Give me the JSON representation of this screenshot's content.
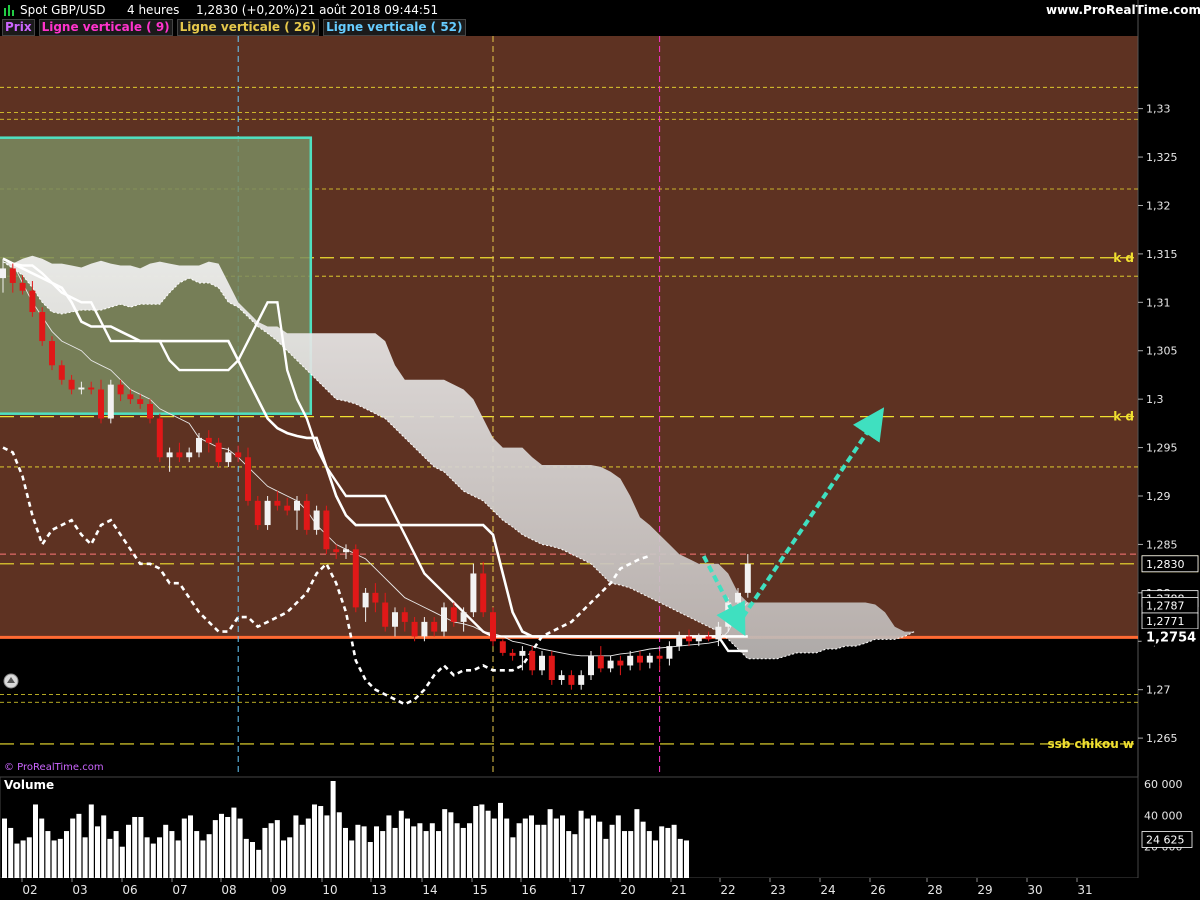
{
  "header": {
    "instrument": "Spot GBP/USD",
    "timeframe": "4 heures",
    "last_change": "1,2830 (+0,20%)",
    "datetime": "21 août 2018 09:44:51",
    "site": "www.ProRealTime.com"
  },
  "legend": [
    {
      "label": "Prix",
      "color": "#cc66ff"
    },
    {
      "label": "Ligne verticale ( 9)",
      "color": "#ff33cc"
    },
    {
      "label": "Ligne verticale ( 26)",
      "color": "#e6c84b"
    },
    {
      "label": "Ligne verticale ( 52)",
      "color": "#66ccff"
    }
  ],
  "watermark": "© ProRealTime.com",
  "colors": {
    "upper_zone": "#5e3222",
    "lower_zone": "#000000",
    "bull_candle": "#f2f2f2",
    "bear_candle": "#e01818",
    "support_line": "#ff6a33",
    "box_fill": "#7a8c60",
    "box_border": "#4fe0c0",
    "arrow": "#3fe0c0",
    "level_line": "#f0e030",
    "cloud": "#bdb8b6"
  },
  "chart_data": {
    "type": "candlestick",
    "y_axis": {
      "ticks": [
        "1,33",
        "1,325",
        "1,32",
        "1,315",
        "1,31",
        "1,305",
        "1,3",
        "1,295",
        "1,29",
        "1,285",
        "1,28",
        "1,275",
        "1,27",
        "1,265"
      ],
      "range": [
        1.2615,
        1.3375
      ]
    },
    "x_axis": {
      "ticks": [
        "02",
        "03",
        "06",
        "07",
        "08",
        "09",
        "10",
        "13",
        "14",
        "15",
        "16",
        "17",
        "20",
        "21",
        "22",
        "23",
        "24",
        "26",
        "28",
        "29",
        "30",
        "31"
      ]
    },
    "price_badges": [
      {
        "text": "1,2830",
        "value": 1.283,
        "style": "last"
      },
      {
        "text": "1,2830",
        "value": 1.283,
        "style": "dark"
      },
      {
        "text": "1,2788",
        "value": 1.2794,
        "style": "dark"
      },
      {
        "text": "1,2787",
        "value": 1.2787,
        "style": "dark"
      },
      {
        "text": "1,2771",
        "value": 1.2771,
        "style": "dark"
      },
      {
        "text": "1,2754",
        "value": 1.2754,
        "style": "support"
      }
    ],
    "level_labels": [
      {
        "text": "k d",
        "value": 1.3146
      },
      {
        "text": "k d",
        "value": 1.2982
      },
      {
        "text": "ssb chikou w",
        "value": 1.2644
      }
    ],
    "horizontal_levels": [
      1.3322,
      1.3296,
      1.3289,
      1.3217,
      1.3146,
      1.3127,
      1.2982,
      1.293,
      1.283,
      1.2695,
      1.2687,
      1.2644
    ],
    "support_level": 1.2754,
    "red_dash_level": 1.284,
    "vertical_lines": [
      {
        "index": 9,
        "color": "#ff33cc"
      },
      {
        "index": 26,
        "color": "#e6c84b"
      },
      {
        "index": 52,
        "color": "#66ccff"
      }
    ],
    "candles": [
      [
        1.3125,
        1.3145,
        1.311,
        1.3135
      ],
      [
        1.3135,
        1.314,
        1.311,
        1.312
      ],
      [
        1.312,
        1.3128,
        1.3108,
        1.3112
      ],
      [
        1.3112,
        1.3122,
        1.3085,
        1.309
      ],
      [
        1.309,
        1.3095,
        1.3055,
        1.306
      ],
      [
        1.306,
        1.3065,
        1.303,
        1.3035
      ],
      [
        1.3035,
        1.304,
        1.3015,
        1.302
      ],
      [
        1.302,
        1.3025,
        1.3005,
        1.301
      ],
      [
        1.301,
        1.3018,
        1.3005,
        1.3012
      ],
      [
        1.3012,
        1.3018,
        1.3005,
        1.301
      ],
      [
        1.301,
        1.302,
        1.2975,
        1.298
      ],
      [
        1.298,
        1.302,
        1.2975,
        1.3015
      ],
      [
        1.3015,
        1.302,
        1.2998,
        1.3005
      ],
      [
        1.3005,
        1.301,
        1.2995,
        1.3
      ],
      [
        1.3,
        1.3005,
        1.299,
        1.2995
      ],
      [
        1.2995,
        1.3,
        1.2975,
        1.298
      ],
      [
        1.298,
        1.2985,
        1.2935,
        1.294
      ],
      [
        1.294,
        1.295,
        1.2925,
        1.2945
      ],
      [
        1.2945,
        1.2955,
        1.2935,
        1.294
      ],
      [
        1.294,
        1.295,
        1.2935,
        1.2945
      ],
      [
        1.2945,
        1.2965,
        1.294,
        1.296
      ],
      [
        1.296,
        1.2968,
        1.2945,
        1.2955
      ],
      [
        1.2955,
        1.296,
        1.293,
        1.2935
      ],
      [
        1.2935,
        1.295,
        1.293,
        1.2945
      ],
      [
        1.2945,
        1.2952,
        1.2935,
        1.294
      ],
      [
        1.294,
        1.295,
        1.289,
        1.2895
      ],
      [
        1.2895,
        1.29,
        1.2865,
        1.287
      ],
      [
        1.287,
        1.29,
        1.2865,
        1.2895
      ],
      [
        1.2895,
        1.2905,
        1.2885,
        1.289
      ],
      [
        1.289,
        1.2898,
        1.288,
        1.2885
      ],
      [
        1.2885,
        1.29,
        1.2865,
        1.2895
      ],
      [
        1.2895,
        1.2902,
        1.286,
        1.2865
      ],
      [
        1.2865,
        1.289,
        1.286,
        1.2885
      ],
      [
        1.2885,
        1.289,
        1.284,
        1.2845
      ],
      [
        1.2845,
        1.285,
        1.2835,
        1.2842
      ],
      [
        1.2842,
        1.285,
        1.2835,
        1.2845
      ],
      [
        1.2845,
        1.285,
        1.278,
        1.2785
      ],
      [
        1.2785,
        1.2805,
        1.277,
        1.28
      ],
      [
        1.28,
        1.281,
        1.278,
        1.279
      ],
      [
        1.279,
        1.28,
        1.276,
        1.2765
      ],
      [
        1.2765,
        1.2785,
        1.2755,
        1.278
      ],
      [
        1.278,
        1.2785,
        1.276,
        1.277
      ],
      [
        1.277,
        1.2775,
        1.275,
        1.2755
      ],
      [
        1.2755,
        1.2775,
        1.275,
        1.277
      ],
      [
        1.277,
        1.2775,
        1.2755,
        1.276
      ],
      [
        1.276,
        1.279,
        1.2755,
        1.2785
      ],
      [
        1.2785,
        1.279,
        1.2765,
        1.277
      ],
      [
        1.277,
        1.2785,
        1.276,
        1.278
      ],
      [
        1.278,
        1.283,
        1.2775,
        1.282
      ],
      [
        1.282,
        1.2832,
        1.2775,
        1.278
      ],
      [
        1.278,
        1.2785,
        1.2745,
        1.275
      ],
      [
        1.275,
        1.2752,
        1.2735,
        1.2738
      ],
      [
        1.2738,
        1.2742,
        1.273,
        1.2735
      ],
      [
        1.2735,
        1.2745,
        1.272,
        1.274
      ],
      [
        1.274,
        1.2745,
        1.2715,
        1.272
      ],
      [
        1.272,
        1.274,
        1.2715,
        1.2735
      ],
      [
        1.2735,
        1.274,
        1.2705,
        1.271
      ],
      [
        1.271,
        1.272,
        1.2705,
        1.2715
      ],
      [
        1.2715,
        1.272,
        1.27,
        1.2705
      ],
      [
        1.2705,
        1.272,
        1.27,
        1.2715
      ],
      [
        1.2715,
        1.274,
        1.271,
        1.2735
      ],
      [
        1.2735,
        1.2745,
        1.2718,
        1.2722
      ],
      [
        1.2722,
        1.2735,
        1.2718,
        1.273
      ],
      [
        1.273,
        1.2735,
        1.2715,
        1.2725
      ],
      [
        1.2725,
        1.274,
        1.272,
        1.2735
      ],
      [
        1.2735,
        1.274,
        1.272,
        1.2728
      ],
      [
        1.2728,
        1.2738,
        1.2722,
        1.2735
      ],
      [
        1.2735,
        1.274,
        1.272,
        1.2732
      ],
      [
        1.2732,
        1.275,
        1.2725,
        1.2745
      ],
      [
        1.2745,
        1.276,
        1.274,
        1.2755
      ],
      [
        1.2755,
        1.2762,
        1.2745,
        1.275
      ],
      [
        1.275,
        1.2758,
        1.2745,
        1.2755
      ],
      [
        1.2755,
        1.276,
        1.275,
        1.2752
      ],
      [
        1.2752,
        1.277,
        1.2745,
        1.2765
      ],
      [
        1.2765,
        1.2795,
        1.276,
        1.279
      ],
      [
        1.279,
        1.2805,
        1.2785,
        1.28
      ],
      [
        1.28,
        1.284,
        1.2795,
        1.283
      ]
    ],
    "tenkan": [
      1.3145,
      1.314,
      1.3138,
      1.3138,
      1.313,
      1.312,
      1.311,
      1.3105,
      1.31,
      1.31,
      1.308,
      1.306,
      1.306,
      1.306,
      1.306,
      1.306,
      1.306,
      1.304,
      1.303,
      1.303,
      1.303,
      1.303,
      1.303,
      1.303,
      1.304,
      1.306,
      1.308,
      1.31,
      1.31,
      1.303,
      1.3,
      1.298,
      1.295,
      1.293,
      1.2915,
      1.29,
      1.29,
      1.29,
      1.29,
      1.29,
      1.288,
      1.286,
      1.284,
      1.282,
      1.281,
      1.28,
      1.279,
      1.278,
      1.277,
      1.276,
      1.2755,
      1.2755,
      1.2755,
      1.2755,
      1.2755,
      1.2755,
      1.2755,
      1.2755,
      1.2755,
      1.2755,
      1.2755,
      1.2755,
      1.2755,
      1.2755,
      1.2755,
      1.2755,
      1.2755,
      1.2755,
      1.2755,
      1.2755,
      1.2755,
      1.2755,
      1.2755,
      1.2755,
      1.274,
      1.274,
      1.274
    ],
    "kijun": [
      1.3145,
      1.314,
      1.3135,
      1.313,
      1.3125,
      1.312,
      1.3115,
      1.31,
      1.308,
      1.3075,
      1.3075,
      1.3075,
      1.307,
      1.3065,
      1.306,
      1.306,
      1.306,
      1.306,
      1.306,
      1.306,
      1.306,
      1.306,
      1.306,
      1.306,
      1.304,
      1.302,
      1.3,
      1.298,
      1.297,
      1.2965,
      1.2962,
      1.296,
      1.296,
      1.293,
      1.29,
      1.288,
      1.287,
      1.287,
      1.287,
      1.287,
      1.287,
      1.287,
      1.287,
      1.287,
      1.287,
      1.287,
      1.287,
      1.287,
      1.287,
      1.287,
      1.286,
      1.282,
      1.278,
      1.276,
      1.2755,
      1.2755,
      1.2755,
      1.2755,
      1.2755,
      1.2755,
      1.2755,
      1.2755,
      1.2755,
      1.2755,
      1.2755,
      1.2755,
      1.2755,
      1.2755,
      1.2755,
      1.2755,
      1.2755,
      1.2755,
      1.2755,
      1.2755,
      1.2755,
      1.2755,
      1.2755
    ],
    "kijun_thin": [
      1.3145,
      1.314,
      1.312,
      1.31,
      1.3085,
      1.307,
      1.306,
      1.3055,
      1.305,
      1.304,
      1.3035,
      1.303,
      1.302,
      1.301,
      1.3005,
      1.3,
      1.299,
      1.2985,
      1.298,
      1.2975,
      1.296,
      1.2955,
      1.295,
      1.2948,
      1.294,
      1.293,
      1.292,
      1.291,
      1.2905,
      1.29,
      1.2895,
      1.2885,
      1.287,
      1.286,
      1.285,
      1.2845,
      1.284,
      1.2835,
      1.2825,
      1.2815,
      1.2805,
      1.2795,
      1.279,
      1.2785,
      1.278,
      1.2775,
      1.277,
      1.2768,
      1.2765,
      1.276,
      1.2758,
      1.2755,
      1.275,
      1.2748,
      1.2745,
      1.2742,
      1.274,
      1.2738,
      1.2736,
      1.2735,
      1.2735,
      1.2735,
      1.2735,
      1.2737,
      1.2738,
      1.274,
      1.2742,
      1.2743,
      1.2744,
      1.2745,
      1.2746,
      1.2747,
      1.2748,
      1.275,
      1.276,
      1.278,
      1.279
    ],
    "chikou_start_index": 0,
    "chikou": [
      1.295,
      1.2945,
      1.292,
      1.288,
      1.285,
      1.2865,
      1.287,
      1.2875,
      1.286,
      1.285,
      1.287,
      1.2875,
      1.286,
      1.2845,
      1.283,
      1.283,
      1.2825,
      1.281,
      1.281,
      1.2795,
      1.278,
      1.277,
      1.276,
      1.276,
      1.2775,
      1.2775,
      1.2765,
      1.277,
      1.2775,
      1.278,
      1.279,
      1.28,
      1.282,
      1.283,
      1.281,
      1.278,
      1.273,
      1.271,
      1.27,
      1.2695,
      1.269,
      1.2685,
      1.269,
      1.27,
      1.2715,
      1.2725,
      1.2715,
      1.272,
      1.272,
      1.2725,
      1.272,
      1.272,
      1.272,
      1.2725,
      1.274,
      1.2755,
      1.276,
      1.2765,
      1.277,
      1.278,
      1.279,
      1.28,
      1.281,
      1.2825,
      1.283,
      1.2835,
      1.2838
    ],
    "cloud_upper": [
      1.3142,
      1.314,
      1.3145,
      1.3148,
      1.3145,
      1.314,
      1.314,
      1.3138,
      1.3136,
      1.314,
      1.3143,
      1.314,
      1.3138,
      1.3138,
      1.3135,
      1.314,
      1.3142,
      1.314,
      1.3138,
      1.3138,
      1.3138,
      1.3142,
      1.314,
      1.312,
      1.31,
      1.309,
      1.308,
      1.3075,
      1.3075,
      1.3068,
      1.3068,
      1.3068,
      1.3068,
      1.3068,
      1.3068,
      1.3068,
      1.3068,
      1.3068,
      1.3068,
      1.306,
      1.3035,
      1.302,
      1.302,
      1.302,
      1.302,
      1.302,
      1.3015,
      1.301,
      1.3,
      1.298,
      1.296,
      1.295,
      1.295,
      1.295,
      1.294,
      1.2932,
      1.2932,
      1.2932,
      1.2932,
      1.2932,
      1.2932,
      1.293,
      1.2925,
      1.2918,
      1.29,
      1.2878,
      1.287,
      1.286,
      1.285,
      1.284,
      1.2835,
      1.283,
      1.283,
      1.283,
      1.282,
      1.28,
      1.279,
      1.279,
      1.279,
      1.279,
      1.279,
      1.279,
      1.279,
      1.279,
      1.279,
      1.279,
      1.279,
      1.279,
      1.279,
      1.2788,
      1.278,
      1.2765,
      1.276,
      1.276
    ],
    "cloud_lower": [
      1.3142,
      1.3135,
      1.3128,
      1.3115,
      1.31,
      1.309,
      1.3088,
      1.309,
      1.3092,
      1.3092,
      1.3092,
      1.3095,
      1.3098,
      1.3095,
      1.3098,
      1.3098,
      1.3098,
      1.311,
      1.312,
      1.3125,
      1.312,
      1.312,
      1.3115,
      1.31,
      1.3095,
      1.3085,
      1.3075,
      1.3068,
      1.306,
      1.305,
      1.304,
      1.303,
      1.302,
      1.301,
      1.3,
      1.2998,
      1.2995,
      1.299,
      1.2985,
      1.298,
      1.297,
      1.296,
      1.295,
      1.294,
      1.293,
      1.2925,
      1.2915,
      1.2905,
      1.29,
      1.2895,
      1.2885,
      1.2875,
      1.2868,
      1.286,
      1.2855,
      1.285,
      1.2848,
      1.2845,
      1.284,
      1.2835,
      1.283,
      1.282,
      1.281,
      1.2808,
      1.2805,
      1.28,
      1.2795,
      1.279,
      1.2785,
      1.278,
      1.2775,
      1.277,
      1.2765,
      1.276,
      1.2752,
      1.2742,
      1.2732,
      1.2732,
      1.2732,
      1.2732,
      1.2735,
      1.2738,
      1.2738,
      1.2738,
      1.2742,
      1.2742,
      1.2745,
      1.2745,
      1.2748,
      1.2752,
      1.2752,
      1.2752,
      1.2755,
      1.276
    ],
    "box": {
      "x0_index": -1,
      "x1_index": 31,
      "top": 1.327,
      "bottom": 1.2985
    },
    "arrows": [
      {
        "from": [
          71.5,
          1.2838
        ],
        "to": [
          75,
          1.277
        ]
      },
      {
        "from": [
          75.5,
          1.2775
        ],
        "to": [
          89,
          1.2978
        ]
      }
    ],
    "volume": {
      "ticks": [
        "60 000",
        "40 000",
        "20 000"
      ],
      "range": [
        0,
        62000
      ],
      "last_label": "24 625",
      "last_value": 24625,
      "title": "Volume",
      "values": [
        38000,
        32000,
        22000,
        24000,
        26000,
        47000,
        38000,
        30000,
        24000,
        25000,
        30000,
        38000,
        41000,
        26000,
        47000,
        33000,
        40000,
        25000,
        30000,
        20000,
        34000,
        39000,
        39000,
        26000,
        22000,
        26000,
        34000,
        30000,
        24000,
        38000,
        40000,
        30000,
        24000,
        28000,
        37000,
        41000,
        39000,
        45000,
        38000,
        25000,
        23000,
        18000,
        32000,
        35000,
        37000,
        24000,
        26000,
        40000,
        34000,
        38000,
        47000,
        46000,
        40000,
        62000,
        42000,
        32000,
        24000,
        34000,
        33000,
        23000,
        33000,
        30000,
        40000,
        32000,
        43000,
        38000,
        33000,
        35000,
        30000,
        35000,
        30000,
        44000,
        42000,
        35000,
        32000,
        35000,
        46000,
        47000,
        43000,
        38000,
        48000,
        38000,
        26000,
        35000,
        38000,
        40000,
        34000,
        34000,
        44000,
        38000,
        40000,
        30000,
        28000,
        43000,
        38000,
        40000,
        36000,
        25000,
        34000,
        40000,
        30000,
        30000,
        44000,
        36000,
        30000,
        24000,
        33000,
        32000,
        34000,
        25000,
        24000
      ]
    }
  }
}
